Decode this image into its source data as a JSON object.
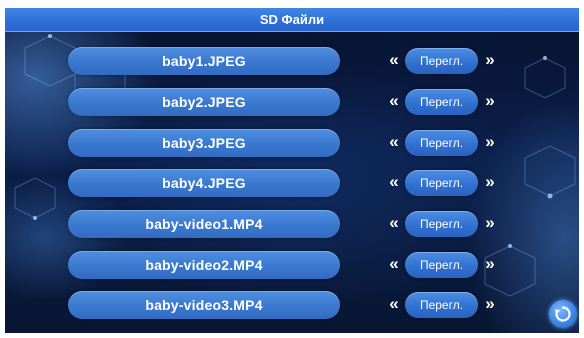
{
  "title": "SD Файли",
  "files": [
    {
      "name": "baby1.JPEG",
      "view_label": "Перегл."
    },
    {
      "name": "baby2.JPEG",
      "view_label": "Перегл."
    },
    {
      "name": "baby3.JPEG",
      "view_label": "Перегл."
    },
    {
      "name": "baby4.JPEG",
      "view_label": "Перегл."
    },
    {
      "name": "baby-video1.MP4",
      "view_label": "Перегл."
    },
    {
      "name": "baby-video2.MP4",
      "view_label": "Перегл."
    },
    {
      "name": "baby-video3.MP4",
      "view_label": "Перегл."
    }
  ],
  "arrow_left_glyph": "«",
  "arrow_right_glyph": "»",
  "icons": {
    "back": "back-icon",
    "prev": "double-chevron-left-icon",
    "next": "double-chevron-right-icon"
  },
  "colors": {
    "title_bar": "#2e6fd8",
    "pill": "#3a78cf",
    "background": "#0b1f4a"
  }
}
